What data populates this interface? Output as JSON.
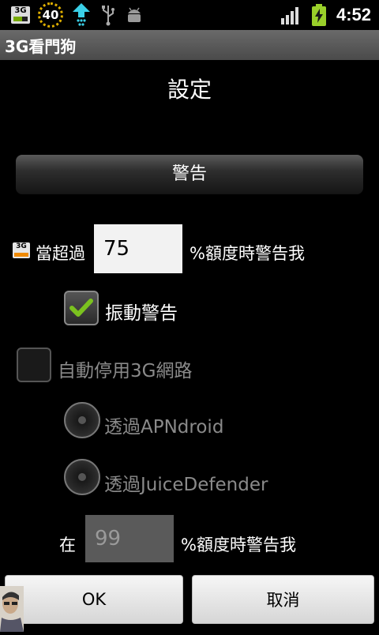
{
  "statusbar": {
    "data_counter": "40",
    "time": "4:52",
    "icons": [
      "3g-data-icon",
      "data-gauge-icon",
      "upload-arrow-icon",
      "usb-icon",
      "android-debug-icon",
      "signal-icon",
      "battery-charging-icon"
    ]
  },
  "app": {
    "title": "3G看門狗"
  },
  "dialog": {
    "title": "設定",
    "section_label": "警告",
    "threshold_prefix": "當超過",
    "threshold_value": "75",
    "threshold_suffix": "%額度時警告我",
    "vibrate_label": "振動警告",
    "vibrate_checked": true,
    "disable3g_label": "自動停用3G網路",
    "disable3g_checked": false,
    "radio_apndroid_label": "透過APNdroid",
    "radio_juice_label": "透過JuiceDefender",
    "second_prefix": "在",
    "second_value": "99",
    "second_suffix": "%額度時警告我",
    "ok_label": "OK",
    "cancel_label": "取消"
  },
  "colors": {
    "checkmark": "#7bc21f",
    "titlebar": "#5a5a5a",
    "data_usage_accent": "#f08a00"
  }
}
